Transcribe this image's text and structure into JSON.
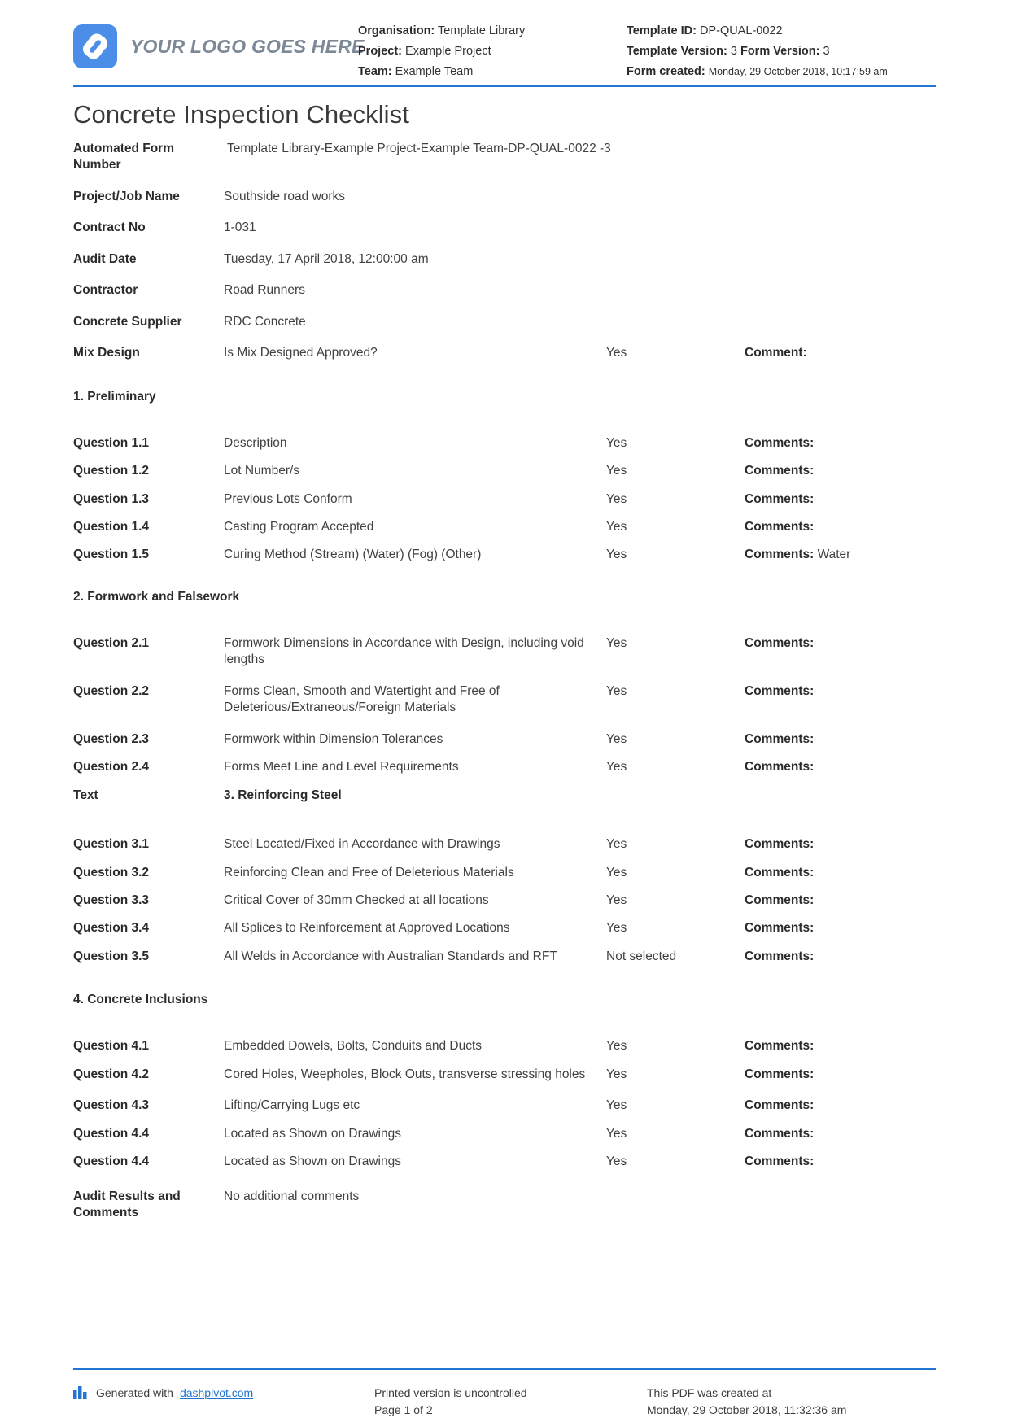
{
  "brand": {
    "logo_text": "YOUR LOGO GOES HERE",
    "logo_color": "#4a8ee8",
    "accent_color": "#2176d2"
  },
  "header": {
    "left": [
      {
        "label": "Organisation:",
        "value": "Template Library"
      },
      {
        "label": "Project:",
        "value": "Example Project"
      },
      {
        "label": "Team:",
        "value": "Example Team"
      }
    ],
    "right": {
      "template_id_label": "Template ID:",
      "template_id_value": "DP-QUAL-0022",
      "template_version_label": "Template Version:",
      "template_version_value": "3",
      "form_version_label": "Form Version:",
      "form_version_value": "3",
      "form_created_label": "Form created:",
      "form_created_value": "Monday, 29 October 2018, 10:17:59 am"
    }
  },
  "document": {
    "title": "Concrete Inspection Checklist"
  },
  "fields": [
    {
      "label": "Automated Form Number",
      "value": "Template Library-Example Project-Example Team-DP-QUAL-0022   -3"
    },
    {
      "label": "Project/Job Name",
      "value": "Southside road works"
    },
    {
      "label": "Contract No",
      "value": "1-031"
    },
    {
      "label": "Audit Date",
      "value": "Tuesday, 17 April 2018, 12:00:00 am"
    },
    {
      "label": "Contractor",
      "value": "Road Runners"
    },
    {
      "label": "Concrete Supplier",
      "value": "RDC Concrete"
    }
  ],
  "mix_design": {
    "label": "Mix Design",
    "description": "Is Mix Designed Approved?",
    "answer": "Yes",
    "comment_label": "Comment:",
    "comment_value": ""
  },
  "sections": [
    {
      "heading": "1. Preliminary",
      "rows": [
        {
          "label": "Question 1.1",
          "description": "Description",
          "answer": "Yes",
          "comment_label": "Comments:",
          "comment_value": ""
        },
        {
          "label": "Question 1.2",
          "description": "Lot Number/s",
          "answer": "Yes",
          "comment_label": "Comments:",
          "comment_value": ""
        },
        {
          "label": "Question 1.3",
          "description": "Previous Lots Conform",
          "answer": "Yes",
          "comment_label": "Comments:",
          "comment_value": ""
        },
        {
          "label": "Question 1.4",
          "description": "Casting Program Accepted",
          "answer": "Yes",
          "comment_label": "Comments:",
          "comment_value": ""
        },
        {
          "label": "Question 1.5",
          "description": "Curing Method (Stream) (Water) (Fog) (Other)",
          "answer": "Yes",
          "comment_label": "Comments:",
          "comment_value": "Water"
        }
      ]
    },
    {
      "heading": "2. Formwork and Falsework",
      "rows": [
        {
          "label": "Question 2.1",
          "description": "Formwork Dimensions in Accordance with Design, including void lengths",
          "answer": "Yes",
          "comment_label": "Comments:",
          "comment_value": ""
        },
        {
          "label": "Question 2.2",
          "description": "Forms Clean, Smooth and Watertight and Free of Deleterious/Extraneous/Foreign Materials",
          "answer": "Yes",
          "comment_label": "Comments:",
          "comment_value": ""
        },
        {
          "label": "Question 2.3",
          "description": "Formwork within Dimension Tolerances",
          "answer": "Yes",
          "comment_label": "Comments:",
          "comment_value": ""
        },
        {
          "label": "Question 2.4",
          "description": "Forms Meet Line and Level Requirements",
          "answer": "Yes",
          "comment_label": "Comments:",
          "comment_value": ""
        }
      ]
    },
    {
      "heading": "",
      "text_row": {
        "label": "Text",
        "description": "3. Reinforcing Steel"
      },
      "rows": [
        {
          "label": "Question 3.1",
          "description": "Steel Located/Fixed in Accordance with Drawings",
          "answer": "Yes",
          "comment_label": "Comments:",
          "comment_value": ""
        },
        {
          "label": "Question 3.2",
          "description": "Reinforcing Clean and Free of Deleterious Materials",
          "answer": "Yes",
          "comment_label": "Comments:",
          "comment_value": ""
        },
        {
          "label": "Question 3.3",
          "description": "Critical Cover of 30mm Checked at all locations",
          "answer": "Yes",
          "comment_label": "Comments:",
          "comment_value": ""
        },
        {
          "label": "Question 3.4",
          "description": "All Splices to Reinforcement at Approved Locations",
          "answer": "Yes",
          "comment_label": "Comments:",
          "comment_value": ""
        },
        {
          "label": "Question 3.5",
          "description": "All Welds in Accordance with Australian Standards and RFT",
          "answer": "Not selected",
          "comment_label": "Comments:",
          "comment_value": ""
        }
      ]
    },
    {
      "heading": "4. Concrete Inclusions",
      "rows": [
        {
          "label": "Question 4.1",
          "description": "Embedded Dowels, Bolts, Conduits and Ducts",
          "answer": "Yes",
          "comment_label": "Comments:",
          "comment_value": ""
        },
        {
          "label": "Question 4.2",
          "description": "Cored Holes, Weepholes, Block Outs, transverse stressing holes",
          "answer": "Yes",
          "comment_label": "Comments:",
          "comment_value": ""
        },
        {
          "label": "Question 4.3",
          "description": "Lifting/Carrying Lugs etc",
          "answer": "Yes",
          "comment_label": "Comments:",
          "comment_value": ""
        },
        {
          "label": "Question 4.4",
          "description": "Located as Shown on Drawings",
          "answer": "Yes",
          "comment_label": "Comments:",
          "comment_value": ""
        },
        {
          "label": "Question 4.4",
          "description": "Located as Shown on Drawings",
          "answer": "Yes",
          "comment_label": "Comments:",
          "comment_value": ""
        }
      ]
    }
  ],
  "audit_results": {
    "label": "Audit Results and Comments",
    "value": "No additional comments"
  },
  "footer": {
    "generated_prefix": "Generated with",
    "generated_link": "dashpivot.com",
    "printed_line1": "Printed version is uncontrolled",
    "printed_line2": "Page 1 of 2",
    "created_line1": "This PDF was created at",
    "created_line2": "Monday, 29 October 2018, 11:32:36 am"
  }
}
